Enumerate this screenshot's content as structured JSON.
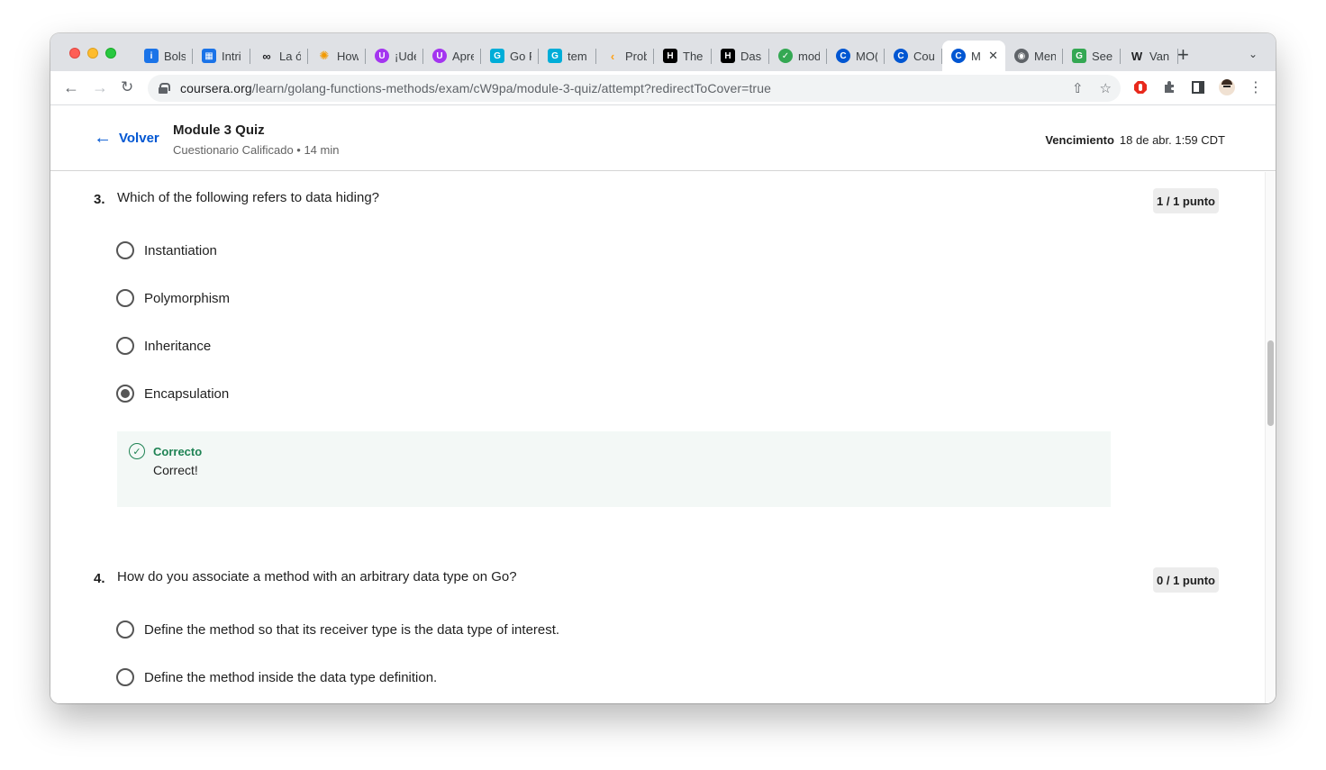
{
  "browser": {
    "tabs": [
      {
        "label": "Bols",
        "icon": "info-icon",
        "color": "#1a73e8"
      },
      {
        "label": "Intri",
        "icon": "layout-icon",
        "color": "#1a73e8"
      },
      {
        "label": "La ó",
        "icon": "infinity-icon",
        "color": "#202124"
      },
      {
        "label": "How",
        "icon": "sun-icon",
        "color": "#f29900"
      },
      {
        "label": "¡Ude",
        "icon": "udemy-icon",
        "color": "#a435f0"
      },
      {
        "label": "Apre",
        "icon": "udemy-icon",
        "color": "#a435f0"
      },
      {
        "label": "Go F",
        "icon": "gopher-icon",
        "color": "#00add8"
      },
      {
        "label": "tem",
        "icon": "gopher-icon",
        "color": "#00add8"
      },
      {
        "label": "Prob",
        "icon": "leetcode-icon",
        "color": "#ffa116"
      },
      {
        "label": "The",
        "icon": "hn-icon",
        "color": "#000000"
      },
      {
        "label": "Dasl",
        "icon": "hn-icon",
        "color": "#000000"
      },
      {
        "label": "mod",
        "icon": "check-icon",
        "color": "#34a853"
      },
      {
        "label": "MO(",
        "icon": "coursera-icon",
        "color": "#0056d2"
      },
      {
        "label": "Cou",
        "icon": "coursera-icon",
        "color": "#0056d2"
      },
      {
        "label": "M",
        "icon": "coursera-icon",
        "color": "#0056d2",
        "active": true
      },
      {
        "label": "Men",
        "icon": "globe-icon",
        "color": "#5f6368"
      },
      {
        "label": "Seel",
        "icon": "gplay-icon",
        "color": "#34a853"
      },
      {
        "label": "Van",
        "icon": "wikipedia-icon",
        "color": "#202124"
      }
    ],
    "url_host": "coursera.org",
    "url_path": "/learn/golang-functions-methods/exam/cW9pa/module-3-quiz/attempt?redirectToCover=true"
  },
  "header": {
    "back_label": "Volver",
    "title": "Module 3 Quiz",
    "subtitle": "Cuestionario Calificado • 14 min",
    "due_label": "Vencimiento",
    "due_value": "18 de abr. 1:59 CDT"
  },
  "questions": [
    {
      "number": "3.",
      "text": "Which of the following refers to data hiding?",
      "points": "1 / 1 punto",
      "options": [
        "Instantiation",
        "Polymorphism",
        "Inheritance",
        "Encapsulation"
      ],
      "selected": 3,
      "feedback_title": "Correcto",
      "feedback_text": "Correct!"
    },
    {
      "number": "4.",
      "text": "How do you associate a method with an arbitrary data type on Go?",
      "points": "0 / 1 punto",
      "options": [
        "Define the method so that its receiver type is the data type of interest.",
        "Define the method inside the data type definition."
      ]
    }
  ]
}
